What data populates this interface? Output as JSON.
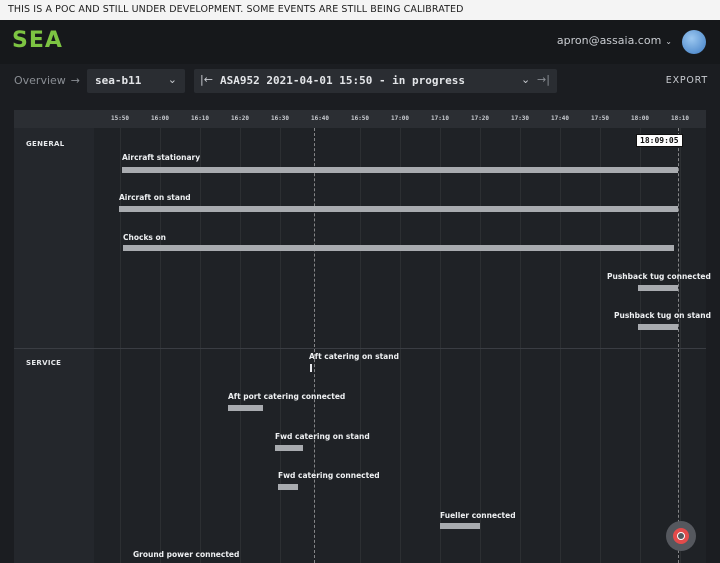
{
  "banner": "THIS IS A POC AND STILL UNDER DEVELOPMENT. SOME EVENTS ARE STILL BEING CALIBRATED",
  "header": {
    "logo": "SEA",
    "user_email": "apron@assaia.com",
    "user_chevron": "⌄"
  },
  "toolbar": {
    "breadcrumb": "Overview",
    "breadcrumb_arrow": "→",
    "stand_select": "sea-b11",
    "stand_chevron": "⌄",
    "turnaround_first": "|←",
    "turnaround_select": "ASA952 2021-04-01 15:50 - in progress",
    "turnaround_chevron": "⌄",
    "turnaround_last": "→|",
    "export_label": "EXPORT"
  },
  "timeline": {
    "ticks": [
      "15:50",
      "16:00",
      "16:10",
      "16:20",
      "16:30",
      "16:40",
      "16:50",
      "17:00",
      "17:10",
      "17:20",
      "17:30",
      "17:40",
      "17:50",
      "18:00",
      "18:10"
    ],
    "current_time": "18:09:05",
    "sections": [
      {
        "name": "GENERAL",
        "events": [
          {
            "label": "Aircraft stationary"
          },
          {
            "label": "Aircraft on stand"
          },
          {
            "label": "Chocks on"
          },
          {
            "label": "Pushback tug connected"
          },
          {
            "label": "Pushback tug on stand"
          }
        ]
      },
      {
        "name": "SERVICE",
        "events": [
          {
            "label": "Aft catering on stand"
          },
          {
            "label": "Aft port catering connected"
          },
          {
            "label": "Fwd catering on stand"
          },
          {
            "label": "Fwd catering connected"
          },
          {
            "label": "Fueller connected"
          },
          {
            "label": "Ground power connected"
          }
        ]
      }
    ]
  },
  "icons": {
    "help": "lifebuoy-icon",
    "avatar": "user-avatar"
  }
}
